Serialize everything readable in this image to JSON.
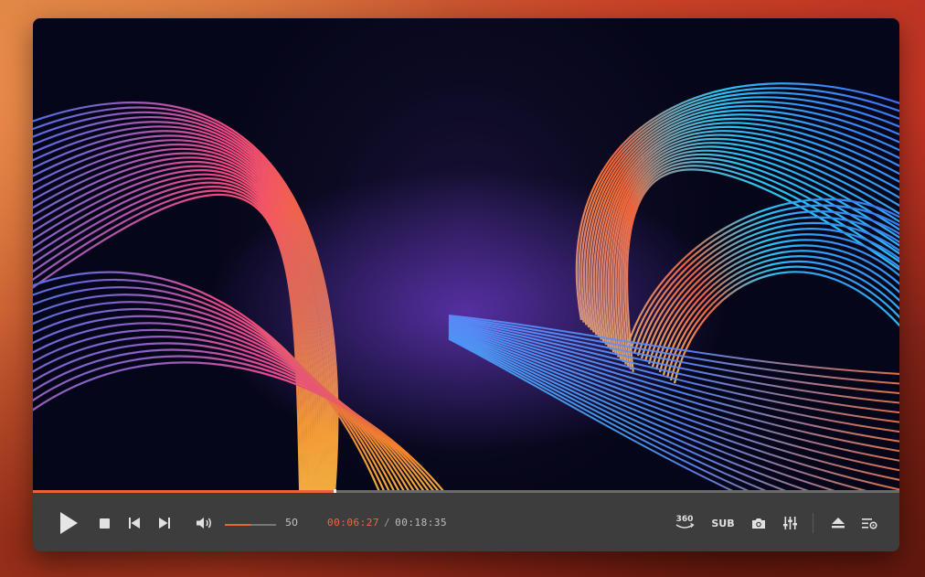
{
  "player": {
    "progress_fraction": 0.348,
    "volume": {
      "value": "50",
      "fraction": 0.5
    },
    "time": {
      "current": "00:06:27",
      "separator": "/",
      "total": "00:18:35"
    },
    "toolbar": {
      "vr_label": "360",
      "subtitle_label": "SUB"
    }
  },
  "colors": {
    "accent": "#e9643b",
    "control_bar": "#3d3d3d",
    "icon": "#e1e1e1"
  },
  "icons": [
    "play-icon",
    "stop-icon",
    "previous-icon",
    "next-icon",
    "volume-icon",
    "vr-360-icon",
    "subtitle-icon",
    "camera-icon",
    "equalizer-icon",
    "eject-icon",
    "playlist-icon"
  ]
}
